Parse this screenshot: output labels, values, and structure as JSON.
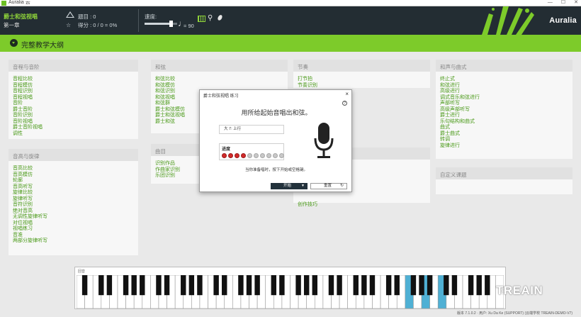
{
  "window": {
    "title": "Auralia 云"
  },
  "header": {
    "lesson_title": "爵士和弦视唱",
    "lesson_chapter": "第一章",
    "question_count": "题目 : 0",
    "score": "得分 : 0 / 0 = 0%",
    "speed_label": "速度:",
    "tempo": "= 90",
    "speed_fraction": 0.8,
    "brand": "Auralia"
  },
  "syllabus": {
    "label": "完整教学大纲"
  },
  "panels": [
    {
      "title": "音程与音阶",
      "items": [
        "音程比较",
        "音程模仿",
        "音程识别",
        "音程视唱",
        "音阶",
        "爵士音阶",
        "音阶识别",
        "音阶视唱",
        "爵士音阶视唱",
        "调性"
      ]
    },
    {
      "title": "音高与旋律",
      "items": [
        "音高比较",
        "音高模仿",
        "轮廓",
        "音高听写",
        "旋律比较",
        "旋律听写",
        "音符识别",
        "绝对音高",
        "无调性旋律听写",
        "对位视唱",
        "视唱练习",
        "音准",
        "两部分旋律听写"
      ]
    },
    {
      "title": "和弦",
      "items": [
        "和弦比较",
        "和弦模仿",
        "和弦识别",
        "和弦视唱",
        "和弦群",
        "爵士和弦模仿",
        "爵士和弦视唱",
        "爵士和弦"
      ]
    },
    {
      "title": "曲目",
      "items": [
        "识别作品",
        "作曲家识别",
        "乐团识别"
      ]
    },
    {
      "title": "节奏",
      "items": [
        "打节拍",
        "节奏识别"
      ]
    },
    {
      "title": "",
      "items": [
        "创作技巧"
      ]
    },
    {
      "title": "和声与曲式",
      "items": [
        "终止式",
        "和弦进行",
        "高级进行",
        "调式音乐和弦进行",
        "声部听写",
        "高级声部听写",
        "爵士进行",
        "乐句结构和曲式",
        "曲式",
        "爵士曲式",
        "转调",
        "旋律进行"
      ]
    },
    {
      "title": "自定义课题",
      "items": []
    }
  ],
  "modal": {
    "title": "爵士和弦视唱 练习",
    "close": "×",
    "help": "?",
    "instruction": "用所给起始音唱出和弦。",
    "prompt": "大 7: 上行",
    "progress_label": "进度",
    "progress": {
      "done": 4,
      "total": 10
    },
    "status": "当你准备唱时，按下开始或空格键。",
    "start_label": "开始",
    "replay_label": "重置"
  },
  "piano": {
    "label": "回音",
    "highlighted_white_keys": [
      40,
      42,
      44
    ]
  },
  "statusbar": {
    "text": "版本 7.1.0.2 · 用户: Xu Da Ke (SUPPORT) (云端学校 TREAIN-DEMO-V7)"
  },
  "watermark": {
    "text": "TREAIN"
  },
  "colors": {
    "accent_green": "#7dcb2a",
    "header_dark": "#232d33",
    "link_green": "#4a9a18",
    "key_highlight": "#4fb0d4",
    "dot_on": "#d22a2a"
  }
}
